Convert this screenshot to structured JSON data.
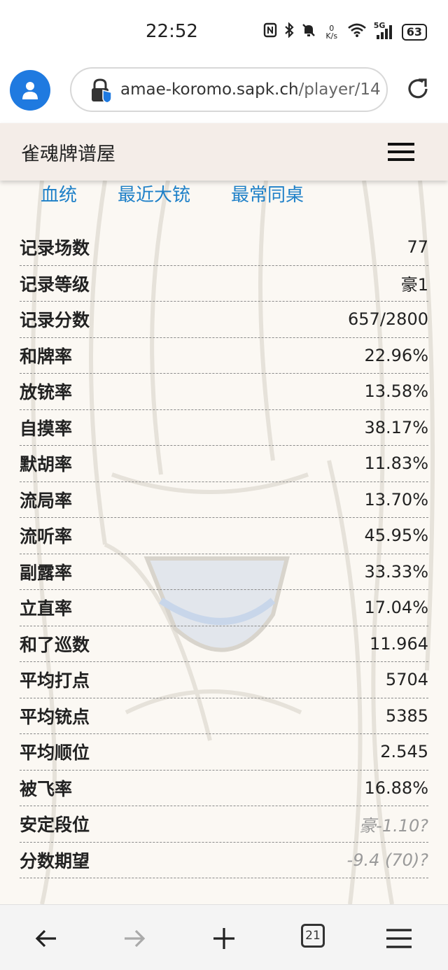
{
  "status_bar": {
    "time": "22:52",
    "net_speed_value": "0",
    "net_speed_unit": "K/s",
    "signal_label": "5G",
    "battery": "63",
    "icons": [
      "nfc-icon",
      "bluetooth-icon",
      "mute-icon",
      "wifi-icon",
      "signal-icon",
      "battery-icon"
    ]
  },
  "browser": {
    "url_host": "amae-koromo.sapk.ch",
    "url_path": "/player/14",
    "tab_count": "21"
  },
  "site": {
    "title": "雀魂牌谱屋"
  },
  "tabs": [
    {
      "label": "血统"
    },
    {
      "label": "最近大铳"
    },
    {
      "label": "最常同桌"
    }
  ],
  "stats": [
    {
      "label": "记录场数",
      "value": "77"
    },
    {
      "label": "记录等级",
      "value": "豪1"
    },
    {
      "label": "记录分数",
      "value": "657/2800"
    },
    {
      "label": "和牌率",
      "value": "22.96%"
    },
    {
      "label": "放铳率",
      "value": "13.58%"
    },
    {
      "label": "自摸率",
      "value": "38.17%"
    },
    {
      "label": "默胡率",
      "value": "11.83%"
    },
    {
      "label": "流局率",
      "value": "13.70%"
    },
    {
      "label": "流听率",
      "value": "45.95%"
    },
    {
      "label": "副露率",
      "value": "33.33%"
    },
    {
      "label": "立直率",
      "value": "17.04%"
    },
    {
      "label": "和了巡数",
      "value": "11.964"
    },
    {
      "label": "平均打点",
      "value": "5704"
    },
    {
      "label": "平均铳点",
      "value": "5385"
    },
    {
      "label": "平均顺位",
      "value": "2.545"
    },
    {
      "label": "被飞率",
      "value": "16.88%"
    },
    {
      "label": "安定段位",
      "value": "豪-1.10?"
    },
    {
      "label": "分数期望",
      "value": "-9.4 (70)?"
    }
  ],
  "colors": {
    "accent_link": "#1e80c8",
    "avatar": "#1f7ae0",
    "header_bg": "#f4ede8"
  }
}
